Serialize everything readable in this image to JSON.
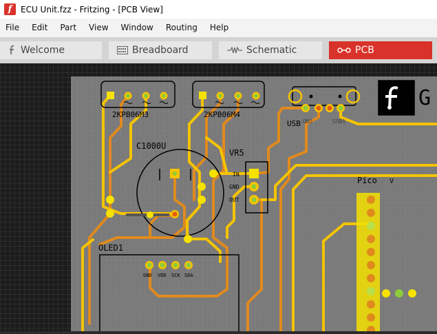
{
  "window": {
    "title": "ECU Unit.fzz - Fritzing - [PCB View]"
  },
  "menu": [
    "File",
    "Edit",
    "Part",
    "View",
    "Window",
    "Routing",
    "Help"
  ],
  "tabs": [
    {
      "label": "Welcome",
      "icon": "fritzing-logo-icon",
      "active": false
    },
    {
      "label": "Breadboard",
      "icon": "breadboard-icon",
      "active": false
    },
    {
      "label": "Schematic",
      "icon": "schematic-resistor-icon",
      "active": false
    },
    {
      "label": "PCB",
      "icon": "pcb-icon",
      "active": true
    }
  ],
  "pcb": {
    "parts": {
      "conn1": "2KPB06M3",
      "conn2": "2KPB06M4",
      "cap": "C1000U",
      "regulator": "VR5",
      "usb": "USB",
      "oled": "OLED1",
      "pico": "Pico",
      "pico_pin_label": "V"
    },
    "reg_pins": [
      "IN",
      "GND",
      "OUT"
    ],
    "oled_pins": [
      "GND",
      "VDD",
      "SCK",
      "SDA"
    ],
    "usb_pins": [
      "GND",
      "VBUS"
    ],
    "logo_letters": "G"
  },
  "colors": {
    "board": "#7a7a7a",
    "trace_top": "#f5c400",
    "trace_bottom": "#e08a1e",
    "silkscreen": "#000000",
    "active_tab": "#d9322a"
  }
}
